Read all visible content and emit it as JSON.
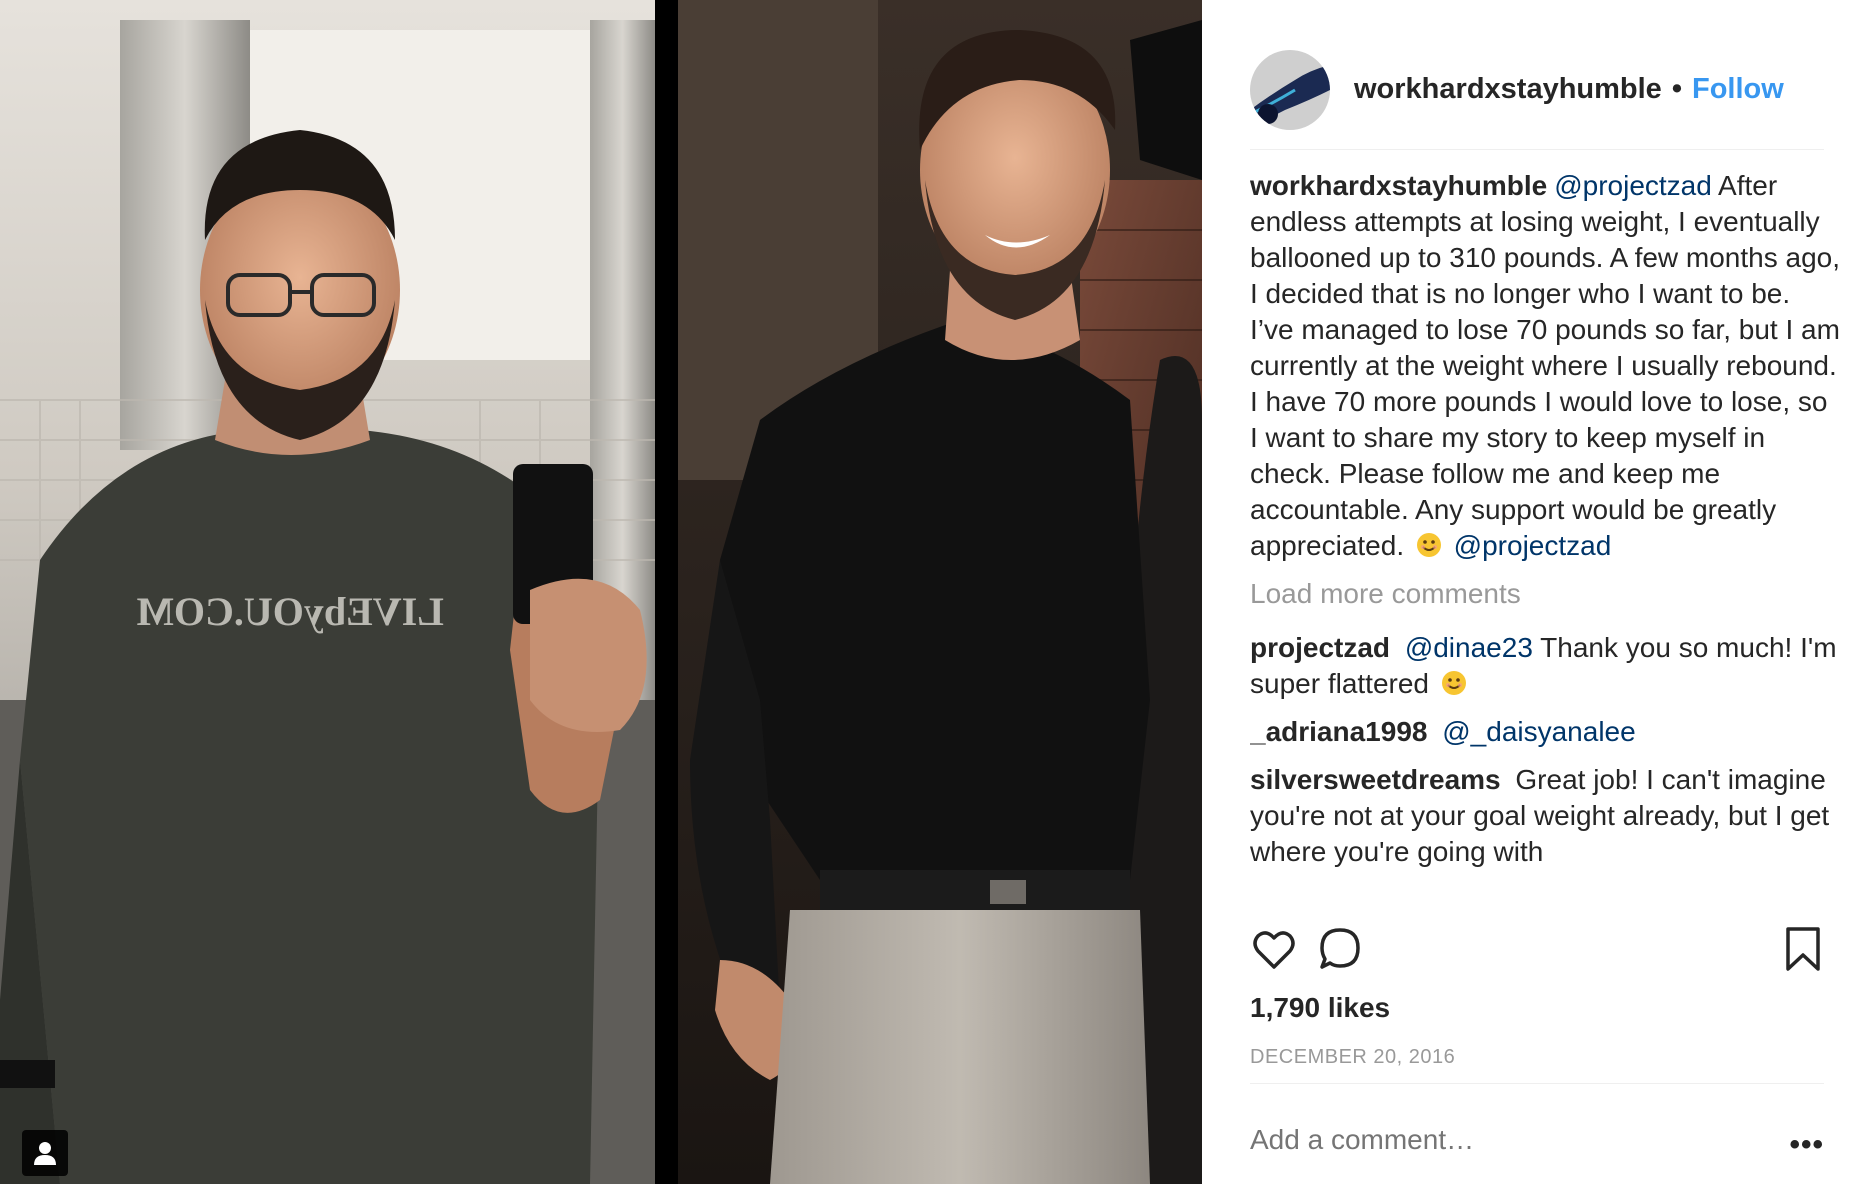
{
  "post": {
    "username": "workhardxstayhumble",
    "follow_label": "Follow",
    "separator": "•"
  },
  "caption": {
    "username": "workhardxstayhumble",
    "mention_start": "@projectzad",
    "text": "After endless attempts at losing weight, I eventually ballooned up to 310 pounds. A few months ago, I decided that is no longer who I want to be. I’ve managed to lose 70 pounds so far, but I am currently at the weight where I usually rebound. I have 70 more pounds I would love to lose, so I want to share my story to keep myself in check. Please follow me and keep me accountable. Any support would be greatly appreciated.",
    "mention_end": "@projectzad"
  },
  "load_more_label": "Load more comments",
  "comments": [
    {
      "username": "projectzad",
      "mention": "@dinae23",
      "text": "Thank you so much! I'm super flattered",
      "emoji": true
    },
    {
      "username": "_adriana1998",
      "mention": "@_daisyanalee",
      "text": "",
      "emoji": false
    },
    {
      "username": "silversweetdreams",
      "mention": "",
      "text": "Great job! I can't imagine you're not at your goal weight already, but I get where you're going with",
      "emoji": false
    }
  ],
  "shirt_print": "LIVEbyOU.COM",
  "likes": "1,790 likes",
  "date": "DECEMBER 20, 2016",
  "add_comment_placeholder": "Add a comment…",
  "more_label": "•••",
  "icons": {
    "like": "heart-icon",
    "comment": "comment-bubble-icon",
    "save": "bookmark-icon",
    "user_tag": "user-tag-icon",
    "more": "more-options-icon"
  },
  "colors": {
    "link": "#3897f0",
    "mention": "#003569",
    "muted": "#999999",
    "text": "#262626"
  }
}
